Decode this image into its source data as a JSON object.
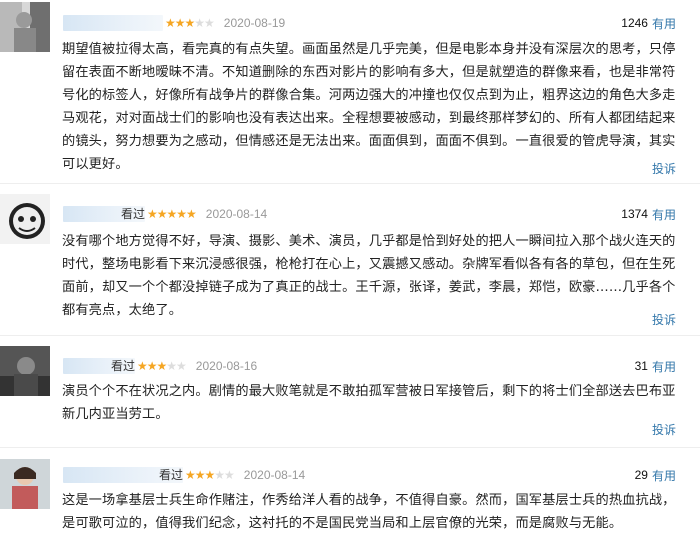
{
  "reviews": [
    {
      "username": "",
      "stars": 3,
      "date": "2020-08-19",
      "votes": "1246",
      "useful_label": "有用",
      "content": "期望值被拉得太高，看完真的有点失望。画面虽然是几乎完美，但是电影本身并没有深层次的思考，只停留在表面不断地暧昧不清。不知道删除的东西对影片的影响有多大，但是就塑造的群像来看，也是非常符号化的标签人，好像所有战争片的群像合集。河两边强大的冲撞也仅仅点到为止，粗界这边的角色大多走马观花，对对面战士们的影响也没有表达出来。全程想要被感动，到最终那样梦幻的、所有人都团结起来的镜头，努力想要为之感动，但情感还是无法出来。面面俱到，面面不俱到。一直很爱的管虎导演，其实可以更好。",
      "report_label": "投诉"
    },
    {
      "username": "看过",
      "stars": 5,
      "date": "2020-08-14",
      "votes": "1374",
      "useful_label": "有用",
      "content": "没有哪个地方觉得不好，导演、摄影、美术、演员，几乎都是恰到好处的把人一瞬间拉入那个战火连天的时代，整场电影看下来沉浸感很强，枪枪打在心上，又震撼又感动。杂牌军看似各有各的草包，但在生死面前，却又一个个都没掉链子成为了真正的战士。王千源，张译，姜武，李晨，郑恺，欧豪……几乎各个都有亮点，太绝了。",
      "report_label": "投诉"
    },
    {
      "username": "看过",
      "stars": 3,
      "date": "2020-08-16",
      "votes": "31",
      "useful_label": "有用",
      "content": "演员个个不在状况之内。剧情的最大败笔就是不敢拍孤军营被日军接管后，剩下的将士们全部送去巴布亚新几内亚当劳工。",
      "report_label": "投诉"
    },
    {
      "username": "看过",
      "stars": 3,
      "date": "2020-08-14",
      "votes": "29",
      "useful_label": "有用",
      "content": "这是一场拿基层士兵生命作赌注，作秀给洋人看的战争，不值得自豪。然而，国军基层士兵的热血抗战，是可歌可泣的，值得我们纪念，这衬托的不是国民党当局和上层官僚的光荣，而是腐败与无能。",
      "report_label": "投诉"
    }
  ]
}
